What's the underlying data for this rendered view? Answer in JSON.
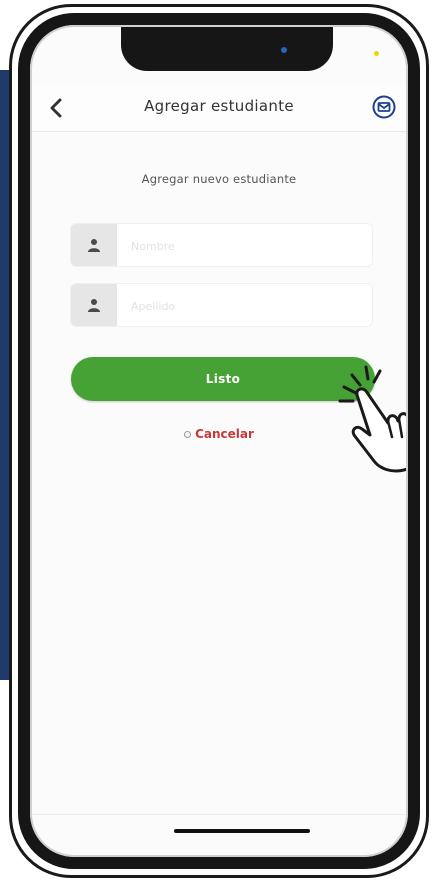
{
  "header": {
    "title": "Agregar estudiante",
    "back_icon": "chevron-left-icon",
    "mail_icon": "mail-icon"
  },
  "form": {
    "subtitle": "Agregar nuevo estudiante",
    "first_name_placeholder": "Nombre",
    "last_name_placeholder": "Apellido",
    "field_icon": "user-icon"
  },
  "actions": {
    "submit_label": "Listo",
    "cancel_label": "Cancelar"
  },
  "colors": {
    "accent_green": "#46a234",
    "cancel_red": "#c83a3a",
    "mail_icon_blue": "#1f3f8f"
  }
}
